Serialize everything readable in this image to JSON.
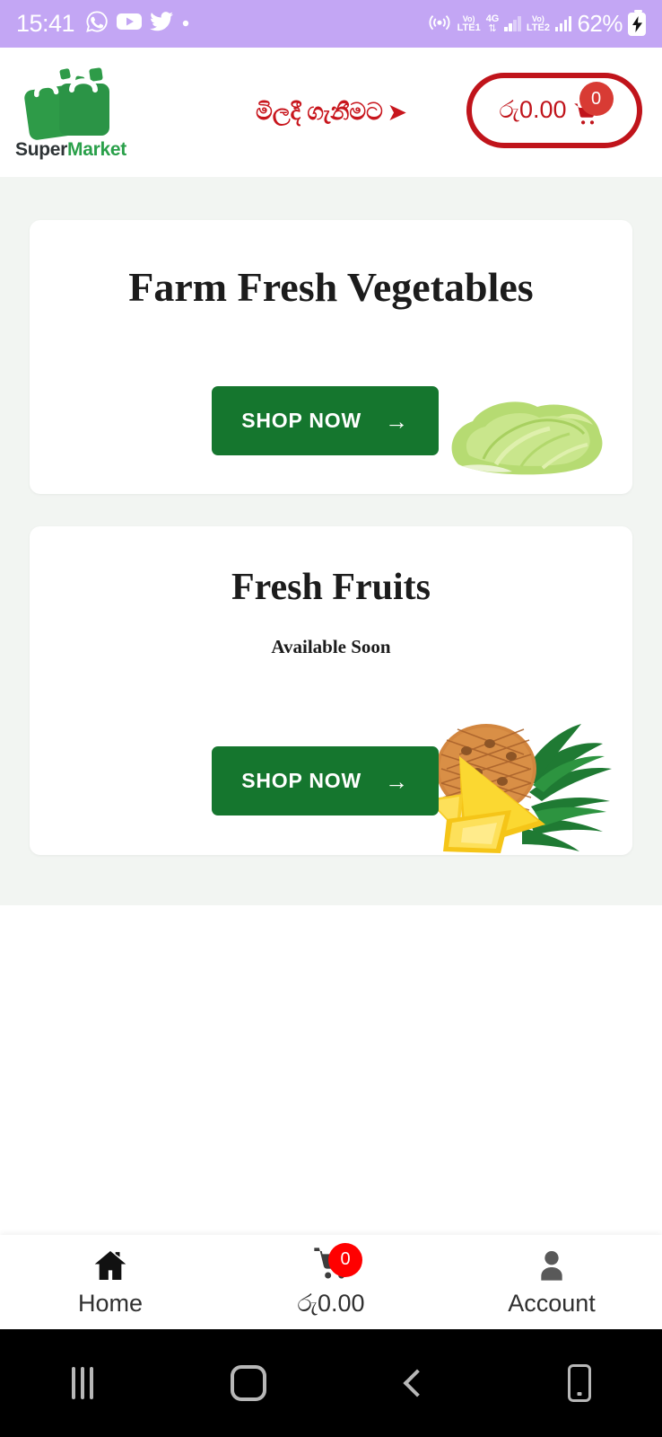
{
  "status_bar": {
    "time": "15:41",
    "battery_percent": "62%",
    "left_icons": [
      "whatsapp-icon",
      "youtube-icon",
      "twitter-icon",
      "dot-icon"
    ],
    "network_1_label_top": "Vo)",
    "network_1_label_bottom": "LTE1",
    "network_type": "4G",
    "network_2_label_top": "Vo)",
    "network_2_label_bottom": "LTE2",
    "right_icons": [
      "hotspot-icon",
      "volte1-icon",
      "4g-data-icon",
      "signal-icon",
      "volte2-icon",
      "signal-icon",
      "battery-icon"
    ],
    "background_color": "#c3a6f4"
  },
  "header": {
    "logo_text_primary": "Super",
    "logo_text_secondary": "Market",
    "promo_text": "මිලදී ගැනීමට",
    "promo_arrow": "➤",
    "cart_amount": "රු0.00",
    "cart_badge_count": "0",
    "accent_color": "#c0141b",
    "logo_green": "#2aa04a"
  },
  "content": {
    "background_color": "#f2f5f2",
    "cards": [
      {
        "title": "Farm Fresh Vegetables",
        "subtitle": "",
        "button_label": "SHOP NOW",
        "button_arrow": "→",
        "image": "lettuce-image",
        "button_color": "#15762e"
      },
      {
        "title": "Fresh Fruits",
        "subtitle": "Available Soon",
        "button_label": "SHOP NOW",
        "button_arrow": "→",
        "image": "pineapple-image",
        "button_color": "#15762e"
      }
    ]
  },
  "bottom_nav": {
    "items": [
      {
        "label": "Home",
        "icon": "home-icon",
        "badge": ""
      },
      {
        "label": "රු0.00",
        "icon": "cart-icon",
        "badge": "0"
      },
      {
        "label": "Account",
        "icon": "account-icon",
        "badge": ""
      }
    ],
    "badge_color": "#ff0000"
  },
  "android_nav": {
    "buttons": [
      "recents-icon",
      "home-icon",
      "back-icon",
      "keyboard-icon"
    ],
    "background_color": "#000000"
  }
}
